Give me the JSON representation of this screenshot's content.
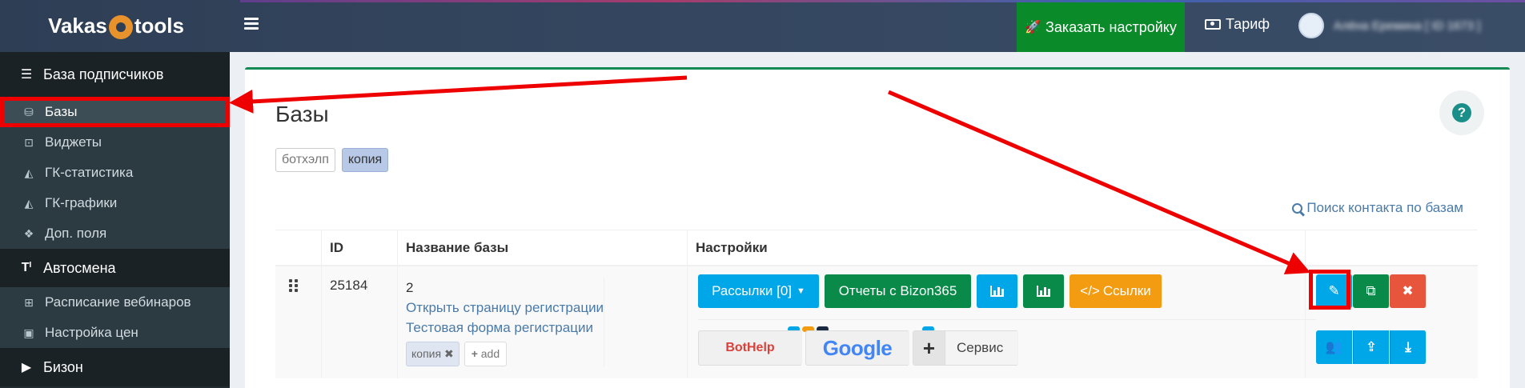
{
  "header": {
    "logo_left": "Vakas",
    "logo_right": "tools",
    "order_label": "Заказать настройку",
    "tariff_label": "Тариф",
    "user_name": "Алёна Еремина [ ID 1673 ]"
  },
  "sidebar": {
    "sections": [
      {
        "label": "База подписчиков",
        "icon": "list-icon"
      },
      {
        "label": "Автосмена",
        "icon": "text-icon"
      },
      {
        "label": "Бизон",
        "icon": "youtube-icon"
      }
    ],
    "items_subscribers": [
      {
        "label": "Базы",
        "icon": "database-icon",
        "active": true
      },
      {
        "label": "Виджеты",
        "icon": "widget-icon"
      },
      {
        "label": "ГК-статистика",
        "icon": "area-chart-icon"
      },
      {
        "label": "ГК-графики",
        "icon": "area-chart-icon"
      },
      {
        "label": "Доп. поля",
        "icon": "cubes-icon"
      }
    ],
    "items_autoswitch": [
      {
        "label": "Расписание вебинаров",
        "icon": "calendar-plus-icon"
      },
      {
        "label": "Настройка цен",
        "icon": "money-icon"
      }
    ]
  },
  "main": {
    "title": "Базы",
    "help": "?",
    "tags": [
      "ботхэлп",
      "копия"
    ],
    "search_link": "Поиск контакта по базам",
    "columns": [
      "ID",
      "Название базы",
      "Настройки"
    ],
    "row": {
      "id": "25184",
      "name_num": "2",
      "link_1": "Открыть страницу регистрации",
      "link_2": "Тестовая форма регистрации",
      "mini_tag": "копия",
      "add_label": "add",
      "btn_mailings": "Рассылки [0]",
      "btn_reports": "Отчеты с Bizon365",
      "btn_links": "Ссылки",
      "svc_bothelp": "BotHelp",
      "svc_google": "Google",
      "svc_service": "Сервис"
    }
  },
  "colors": {
    "accent_blue": "#00a7e8",
    "accent_green": "#0a8a48",
    "accent_orange": "#f39c12",
    "danger_red": "#e8553d",
    "annotation_red": "#ee0000"
  }
}
